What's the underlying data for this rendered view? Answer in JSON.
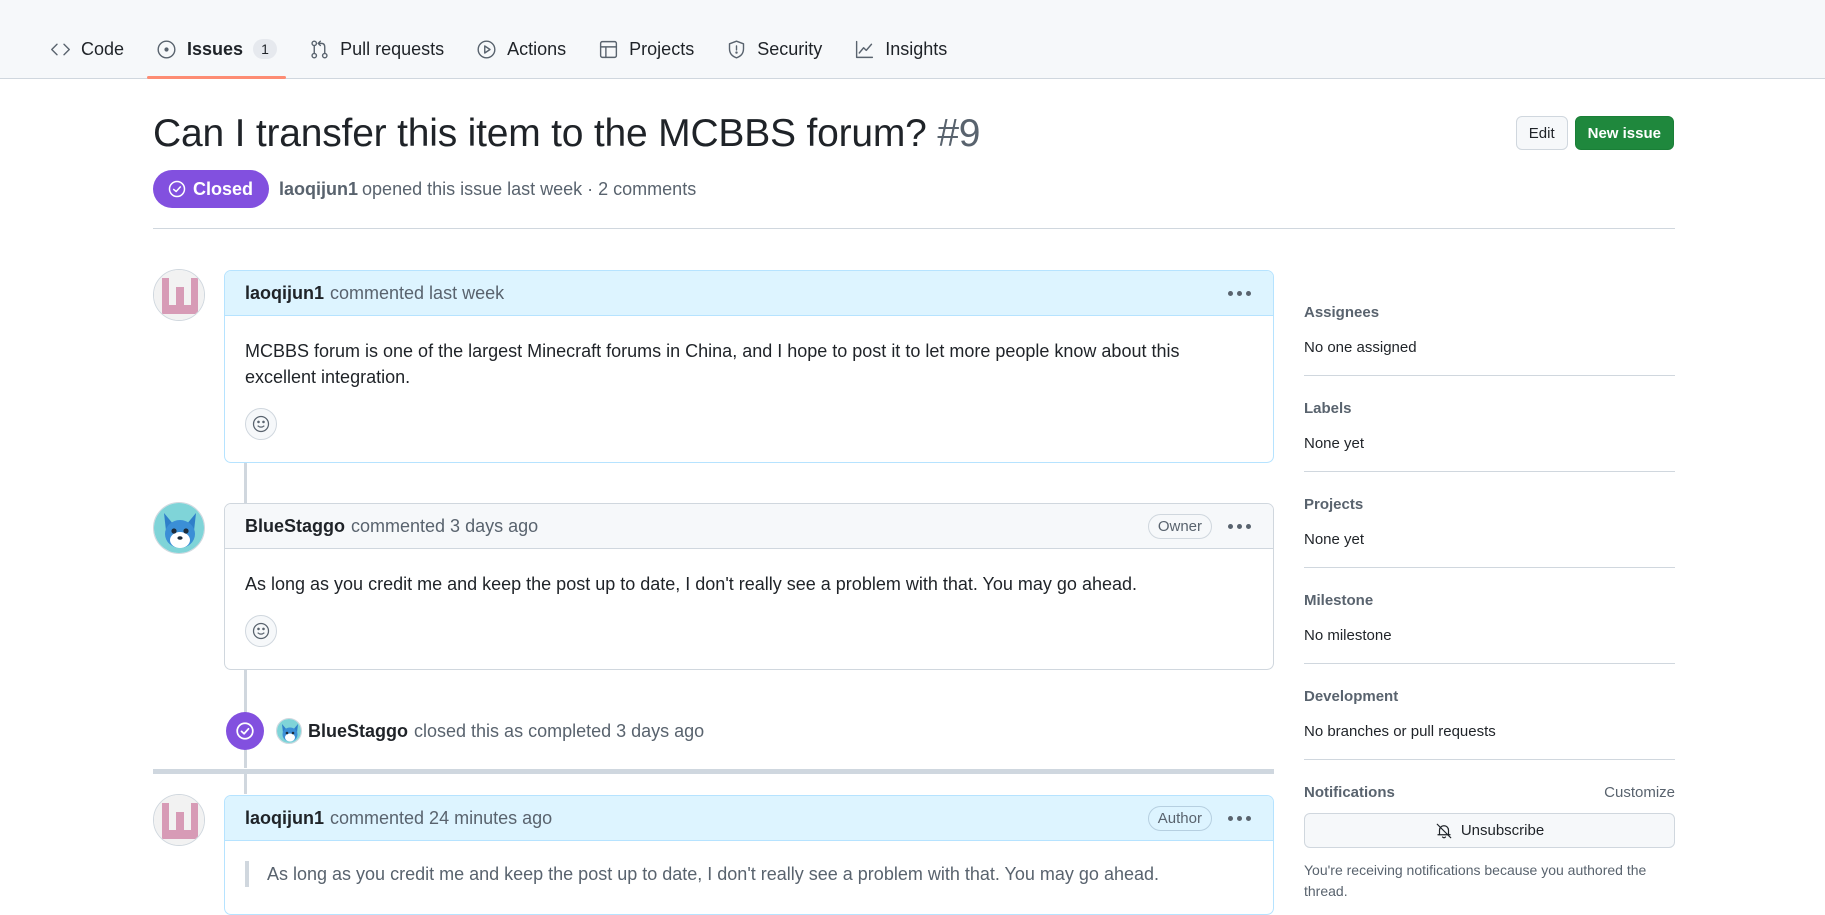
{
  "nav": {
    "tabs": [
      {
        "label": "Code",
        "icon": "code-icon"
      },
      {
        "label": "Issues",
        "icon": "issue-opened-icon",
        "count": "1",
        "selected": true
      },
      {
        "label": "Pull requests",
        "icon": "git-pull-request-icon"
      },
      {
        "label": "Actions",
        "icon": "play-icon"
      },
      {
        "label": "Projects",
        "icon": "table-icon"
      },
      {
        "label": "Security",
        "icon": "shield-icon"
      },
      {
        "label": "Insights",
        "icon": "graph-icon"
      }
    ]
  },
  "issue": {
    "title": "Can I transfer this item to the MCBBS forum?",
    "number": "#9",
    "state": "Closed",
    "state_color": "#8250df",
    "author": "laoqijun1",
    "meta": "opened this issue last week · 2 comments",
    "edit_label": "Edit",
    "new_issue_label": "New issue"
  },
  "comments": [
    {
      "author": "laoqijun1",
      "time": "commented last week",
      "role": "",
      "body": "MCBBS forum is one of the largest Minecraft forums in China, and I hope to post it to let more people know about this excellent integration."
    },
    {
      "author": "BlueStaggo",
      "time": "commented 3 days ago",
      "role": "Owner",
      "body": "As long as you credit me and keep the post up to date, I don't really see a problem with that. You may go ahead."
    },
    {
      "author": "laoqijun1",
      "time": "commented 24 minutes ago",
      "role": "Author",
      "quote": "As long as you credit me and keep the post up to date, I don't really see a problem with that. You may go ahead."
    }
  ],
  "event": {
    "actor": "BlueStaggo",
    "text": "closed this as completed 3 days ago"
  },
  "sidebar": {
    "assignees": {
      "title": "Assignees",
      "value": "No one assigned"
    },
    "labels": {
      "title": "Labels",
      "value": "None yet"
    },
    "projects": {
      "title": "Projects",
      "value": "None yet"
    },
    "milestone": {
      "title": "Milestone",
      "value": "No milestone"
    },
    "development": {
      "title": "Development",
      "value": "No branches or pull requests"
    },
    "notifications": {
      "title": "Notifications",
      "customize": "Customize",
      "unsubscribe": "Unsubscribe",
      "note": "You're receiving notifications because you authored the thread."
    }
  }
}
